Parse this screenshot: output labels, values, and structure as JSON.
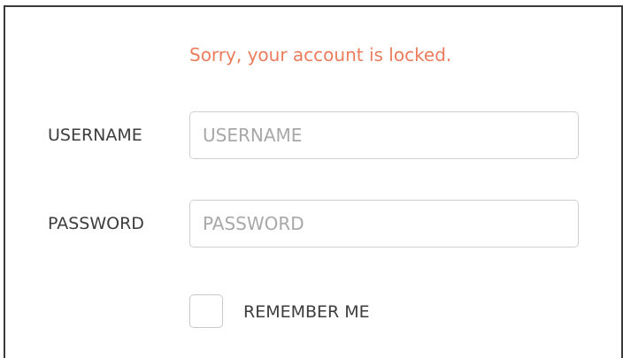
{
  "login": {
    "error_message": "Sorry, your account is locked.",
    "username": {
      "label": "USERNAME",
      "value": "",
      "placeholder": "USERNAME"
    },
    "password": {
      "label": "PASSWORD",
      "value": "",
      "placeholder": "PASSWORD"
    },
    "remember_me": {
      "label": "REMEMBER ME",
      "checked": false
    }
  },
  "colors": {
    "error_text": "#ec7c5c",
    "label_text": "#3d3d3d",
    "placeholder_text": "#a8a8a8",
    "input_border": "#cfcfcf",
    "panel_border": "#3a3a3a"
  }
}
